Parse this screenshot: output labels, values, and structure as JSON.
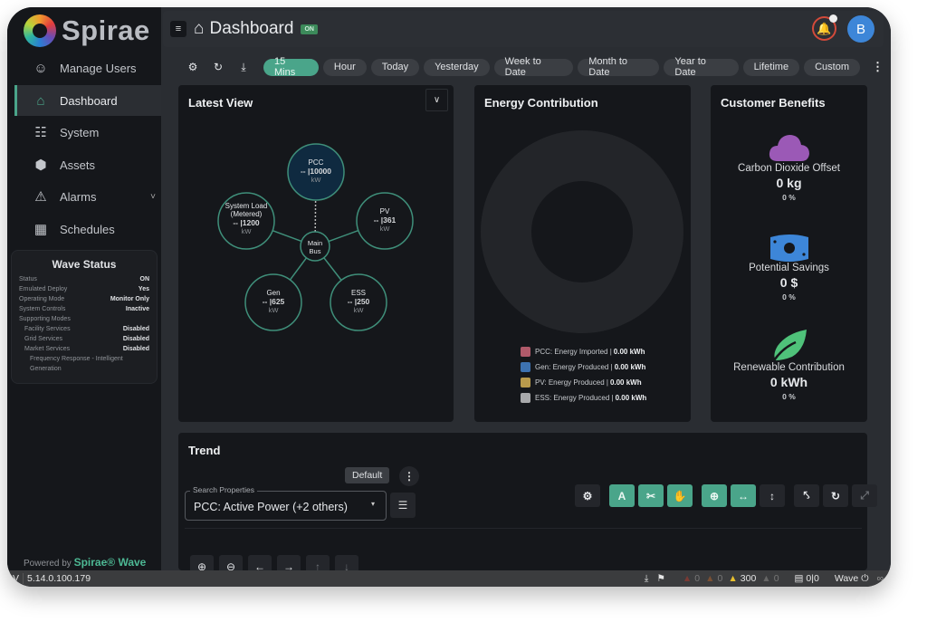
{
  "app": {
    "brand": "Spirae",
    "powered_prefix": "Powered by",
    "powered_brand": "Spirae® Wave"
  },
  "sidebar": {
    "items": [
      {
        "label": "Manage Users",
        "icon": "users-icon",
        "glyph": "☺"
      },
      {
        "label": "Dashboard",
        "icon": "home-icon",
        "glyph": "⌂",
        "active": true
      },
      {
        "label": "System",
        "icon": "network-icon",
        "glyph": "☷"
      },
      {
        "label": "Assets",
        "icon": "cube-icon",
        "glyph": "⬢"
      },
      {
        "label": "Alarms",
        "icon": "warning-icon",
        "glyph": "⚠",
        "chevron": "˅"
      },
      {
        "label": "Schedules",
        "icon": "calendar-icon",
        "glyph": "▦"
      }
    ]
  },
  "wave_status": {
    "title": "Wave Status",
    "rows": [
      {
        "label": "Status",
        "value": "ON"
      },
      {
        "label": "Emulated Deploy",
        "value": "Yes"
      },
      {
        "label": "Operating Mode",
        "value": "Monitor Only"
      },
      {
        "label": "System Controls",
        "value": "Inactive"
      },
      {
        "label": "Supporting Modes",
        "value": ""
      },
      {
        "label": "Facility Services",
        "value": "Disabled"
      },
      {
        "label": "Grid Services",
        "value": "Disabled"
      },
      {
        "label": "Market Services",
        "value": "Disabled"
      },
      {
        "label": "Frequency Response - Intelligent",
        "value": ""
      },
      {
        "label": "Generation",
        "value": ""
      }
    ]
  },
  "header": {
    "menu_glyph": "≡",
    "home_glyph": "⌂",
    "title": "Dashboard",
    "badge": "ON",
    "bell_glyph": "♪",
    "avatar": "B"
  },
  "toolbar": {
    "icons": [
      {
        "name": "settings-icon",
        "glyph": "⚙"
      },
      {
        "name": "refresh-icon",
        "glyph": "↻"
      },
      {
        "name": "download-icon",
        "glyph": "⤓"
      }
    ],
    "ranges": [
      "15 Mins",
      "Hour",
      "Today",
      "Yesterday",
      "Week to Date",
      "Month to Date",
      "Year to Date",
      "Lifetime",
      "Custom"
    ],
    "active_range": "15 Mins",
    "more_glyph": "⋮"
  },
  "latest_view": {
    "title": "Latest View",
    "dropdown_glyph": "⌄",
    "hub": {
      "line1": "Main",
      "line2": "Bus"
    },
    "nodes": [
      {
        "id": "pcc",
        "lines": [
          "PCC"
        ],
        "value": "-- |10000",
        "unit": "kW"
      },
      {
        "id": "pv",
        "lines": [
          "PV"
        ],
        "value": "-- |361",
        "unit": "kW"
      },
      {
        "id": "ess",
        "lines": [
          "ESS"
        ],
        "value": "-- |250",
        "unit": "kW"
      },
      {
        "id": "gen",
        "lines": [
          "Gen"
        ],
        "value": "-- |625",
        "unit": "kW"
      },
      {
        "id": "load",
        "lines": [
          "System Load",
          "(Metered)"
        ],
        "value": "-- |1200",
        "unit": "kW"
      }
    ]
  },
  "energy_contribution": {
    "title": "Energy Contribution",
    "legend": [
      {
        "label": "PCC: Energy Imported |",
        "value": "0.00 kWh",
        "color": "#b05a6a"
      },
      {
        "label": "Gen: Energy Produced |",
        "value": "0.00 kWh",
        "color": "#3d72b0"
      },
      {
        "label": "PV: Energy Produced |",
        "value": "0.00 kWh",
        "color": "#b89a4c"
      },
      {
        "label": "ESS: Energy Produced |",
        "value": "0.00 kWh",
        "color": "#a8a9ab"
      }
    ]
  },
  "customer_benefits": {
    "title": "Customer Benefits",
    "items": [
      {
        "name": "Carbon Dioxide Offset",
        "value": "0 kg",
        "pct": "0 %",
        "icon": "cloud-icon",
        "color": "#9b59b6"
      },
      {
        "name": "Potential Savings",
        "value": "0 $",
        "pct": "0 %",
        "icon": "money-icon",
        "color": "#3d86d8"
      },
      {
        "name": "Renewable Contribution",
        "value": "0 kWh",
        "pct": "0 %",
        "icon": "leaf-icon",
        "color": "#4fc27a"
      }
    ]
  },
  "trend": {
    "title": "Trend",
    "default_label": "Default",
    "more_glyph": "⋮",
    "search_label": "Search Properties",
    "search_value": "PCC: Active Power (+2 others)",
    "caret": "▾",
    "filter_glyph": "☰",
    "chart_tools": [
      {
        "name": "chart-settings-icon",
        "glyph": "⚙",
        "on": false
      },
      {
        "name": "autoscale-icon",
        "glyph": "A",
        "on": true
      },
      {
        "name": "pencil-ruler-icon",
        "glyph": "✂",
        "on": true
      },
      {
        "name": "pan-hand-icon",
        "glyph": "✋",
        "on": true
      },
      {
        "name": "zoom-icon",
        "glyph": "⊕",
        "on": true
      },
      {
        "name": "horizontal-arrows-icon",
        "glyph": "↔",
        "on": true
      },
      {
        "name": "vertical-arrows-icon",
        "glyph": "↕",
        "on": false
      },
      {
        "name": "compress-icon",
        "glyph": "⤣",
        "on": false
      },
      {
        "name": "reset-icon",
        "glyph": "↻",
        "on": false
      },
      {
        "name": "expand-icon",
        "glyph": "⤢",
        "on": false,
        "dim": true
      }
    ],
    "nav_tools": [
      {
        "name": "zoom-in-icon",
        "glyph": "⊕"
      },
      {
        "name": "zoom-out-icon",
        "glyph": "⊖"
      },
      {
        "name": "arrow-left-icon",
        "glyph": "←"
      },
      {
        "name": "arrow-right-icon",
        "glyph": "→"
      },
      {
        "name": "arrow-up-icon",
        "glyph": "↑",
        "dim": true
      },
      {
        "name": "arrow-down-icon",
        "glyph": "↓",
        "dim": true
      }
    ]
  },
  "statusbar": {
    "version_label": "V",
    "version": "5.14.0.100.179",
    "download_glyph": "⤓",
    "tags_glyph": "⚑",
    "alarms": [
      {
        "count": "0",
        "color": "#7a3a34"
      },
      {
        "count": "0",
        "color": "#7a5034"
      },
      {
        "count": "300",
        "color": "#e8c02e",
        "bright": true
      },
      {
        "count": "0",
        "color": "#666"
      }
    ],
    "calendar_glyph": "▤",
    "schedule_counts": "0|0",
    "wave_label": "Wave",
    "power_glyph": "⏻",
    "link_glyph": "∞"
  }
}
